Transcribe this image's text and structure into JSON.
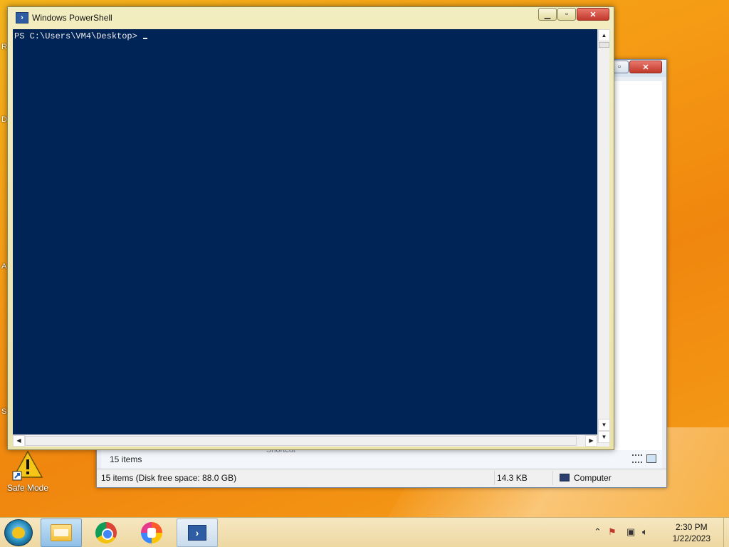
{
  "desktop": {
    "icons": [
      {
        "label": "Safe Mode"
      }
    ],
    "edge_labels": [
      "R",
      "De",
      "A",
      "S"
    ]
  },
  "explorer": {
    "items_count": "15 items",
    "ghost_label": "Shortcut",
    "status": {
      "summary": "15 items (Disk free space: 88.0 GB)",
      "size": "14.3 KB",
      "location": "Computer"
    }
  },
  "powershell": {
    "title": "Windows PowerShell",
    "prompt": "PS C:\\Users\\VM4\\Desktop> ",
    "colors": {
      "console_bg": "#012456",
      "console_fg": "#eeedf0"
    }
  },
  "taskbar": {
    "items": [
      "start-button",
      "file-explorer",
      "chrome",
      "vpn-client",
      "windows-powershell"
    ],
    "clock": {
      "time": "2:30 PM",
      "date": "1/22/2023"
    }
  }
}
